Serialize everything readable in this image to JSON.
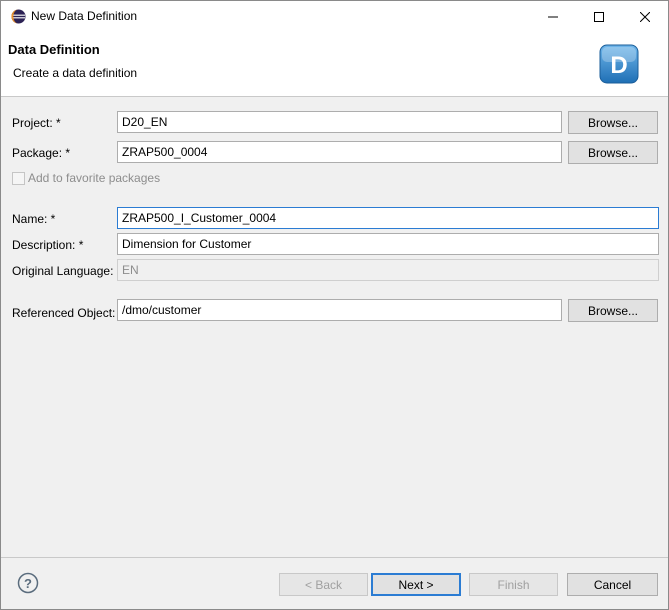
{
  "window": {
    "title": "New Data Definition",
    "icons": {
      "app": "eclipse-icon",
      "minimize": "minimize-icon",
      "maximize": "maximize-icon",
      "close": "close-icon"
    }
  },
  "banner": {
    "title": "Data Definition",
    "subtitle": "Create a data definition",
    "logo_letter": "D",
    "logo_color": "#3a8fd0"
  },
  "form": {
    "project": {
      "label": "Project: *",
      "value": "D20_EN",
      "browse_label": "Browse..."
    },
    "package": {
      "label": "Package: *",
      "value": "ZRAP500_0004",
      "browse_label": "Browse..."
    },
    "favorite": {
      "label": "Add to favorite packages",
      "checked": false
    },
    "name": {
      "label": "Name: *",
      "value": "ZRAP500_I_Customer_0004"
    },
    "description": {
      "label": "Description: *",
      "value": "Dimension for Customer"
    },
    "original_language": {
      "label": "Original Language:",
      "value": "EN"
    },
    "referenced_object": {
      "label": "Referenced Object:",
      "value": "/dmo/customer",
      "browse_label": "Browse..."
    }
  },
  "footer": {
    "help_icon": "help-icon",
    "back_label": "< Back",
    "next_label": "Next >",
    "finish_label": "Finish",
    "cancel_label": "Cancel"
  },
  "colors": {
    "focus_border": "#2b7cd3",
    "dialog_bg": "#f0f0f0"
  }
}
